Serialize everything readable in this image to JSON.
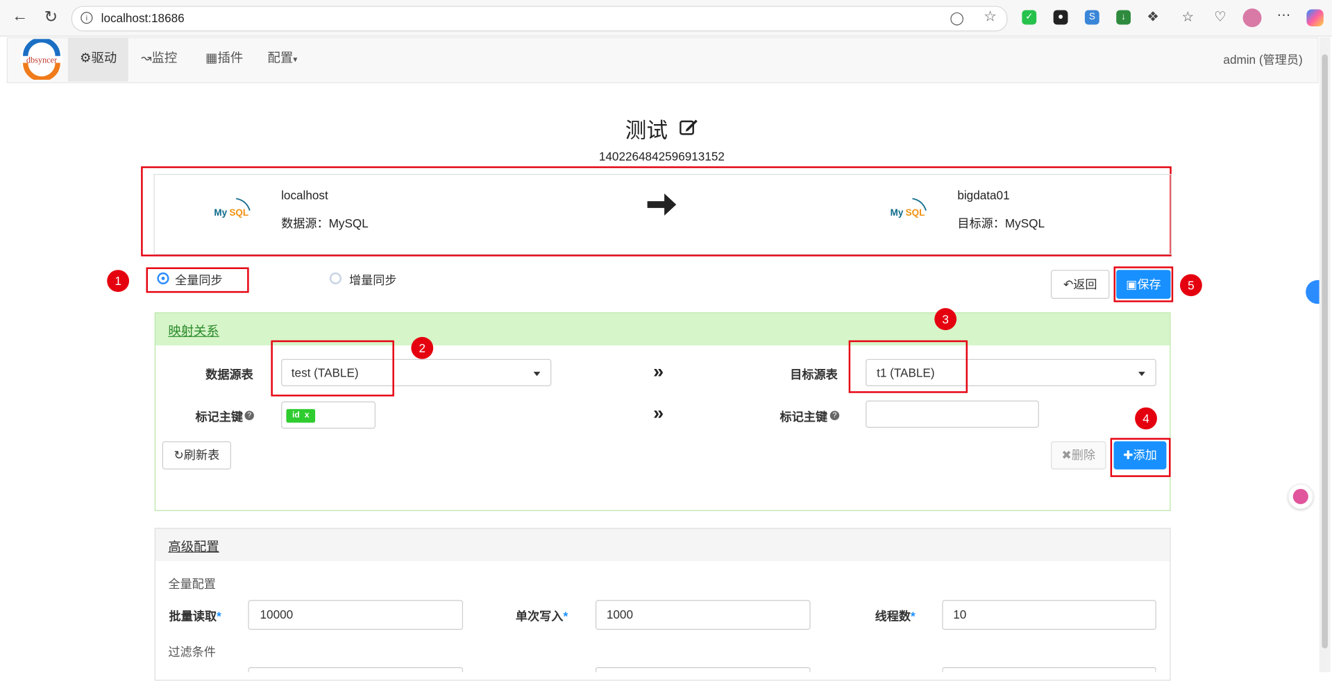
{
  "browser": {
    "url": "localhost:18686",
    "icons": [
      "back-icon",
      "refresh-icon",
      "info-icon",
      "reader-icon",
      "favorite-icon",
      "shield-ext-icon",
      "game-ext-icon",
      "translate-ext-icon",
      "download-ext-icon",
      "puzzle-icon",
      "favorites-list-icon",
      "health-icon",
      "profile-avatar",
      "more-icon",
      "copilot-icon"
    ]
  },
  "appnav": {
    "logo_text": "dbsyncer",
    "items": [
      {
        "label": "驱动",
        "icon": "dashboard-icon"
      },
      {
        "label": "监控",
        "icon": "chart-icon"
      },
      {
        "label": "插件",
        "icon": "plugin-icon"
      },
      {
        "label": "配置",
        "icon": "caret-icon"
      }
    ],
    "user": "admin (管理员)"
  },
  "task": {
    "name": "测试",
    "id": "1402264842596913152"
  },
  "source": {
    "name": "localhost",
    "type_label": "数据源：MySQL"
  },
  "target": {
    "name": "bigdata01",
    "type_label": "目标源：MySQL"
  },
  "sync_mode": {
    "full": "全量同步",
    "incremental": "增量同步",
    "selected": "full"
  },
  "buttons": {
    "back": "返回",
    "save": "保存",
    "refresh": "刷新表",
    "delete": "删除",
    "add": "添加"
  },
  "mapping": {
    "title": "映射关系",
    "source_table_label": "数据源表",
    "source_table_value": "test (TABLE)",
    "target_table_label": "目标源表",
    "target_table_value": "t1 (TABLE)",
    "source_pk_label": "标记主键",
    "target_pk_label": "标记主键",
    "source_pk_tag": "id",
    "tag_remove": "x",
    "target_pk_value": ""
  },
  "advanced": {
    "title": "高级配置",
    "full_section": "全量配置",
    "batch_read_label": "批量读取",
    "batch_read_value": "10000",
    "single_write_label": "单次写入",
    "single_write_value": "1000",
    "threads_label": "线程数",
    "threads_value": "10",
    "filter_section": "过滤条件",
    "required_mark": "*"
  },
  "annotations": [
    "1",
    "2",
    "3",
    "4",
    "5"
  ],
  "colors": {
    "annotation_red": "#e5000f",
    "primary": "#1890ff",
    "mapping_header": "#d6f5c9",
    "tag_green": "#2ecc2e"
  }
}
